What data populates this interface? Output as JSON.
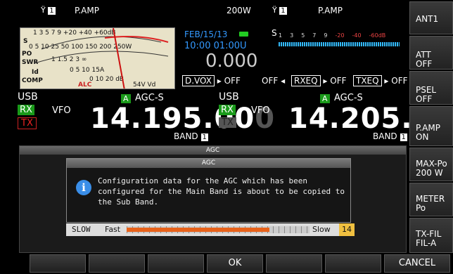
{
  "main": {
    "antenna": "1",
    "pamp": "P.AMP",
    "power": "200W",
    "date": "FEB/15/13",
    "timers": "10:00 01:00U",
    "rit": "0.000",
    "dvox_label": "D.VOX",
    "dvox_state": "OFF",
    "mode": "USB",
    "rx": "RX",
    "tx": "TX",
    "vfo": "VFO",
    "agc": "AGC-S",
    "agc_tag": "A",
    "freq": "14.195.00",
    "freq_last": "0",
    "band": "BAND",
    "band_num": "1"
  },
  "sub": {
    "antenna": "1",
    "pamp": "P.AMP",
    "s_label": "S",
    "off1": "OFF",
    "rxeq": "RXEQ",
    "rxeq_state": "OFF",
    "txeq": "TXEQ",
    "txeq_state": "OFF",
    "mode": "USB",
    "rx": "RX",
    "tx": "TX",
    "vfo": "VFO",
    "agc": "AGC-S",
    "agc_tag": "A",
    "freq": "14.205.00",
    "freq_last": "0",
    "band": "BAND",
    "band_num": "1",
    "scale": [
      "1",
      "3",
      "5",
      "7",
      "9",
      "-20",
      "-40",
      "-60dB"
    ]
  },
  "meter": {
    "s_scale": "1   3   5   7   9   +20   +40   +60dB",
    "po_scale": "0  5  10  25  50  100  150  200  250W",
    "swr_scale": "1    1.5   2    3    ∞",
    "id_scale": "0    5    10   15A",
    "comp_scale": "0    10   20 dB",
    "alc": "ALC",
    "vd_scale": "54V  Vd",
    "labels": [
      "S",
      "PO",
      "SWR",
      "Id",
      "COMP"
    ]
  },
  "right_keys": [
    {
      "l1": "ANT1",
      "l2": ""
    },
    {
      "l1": "ATT",
      "l2": "OFF"
    },
    {
      "l1": "PSEL",
      "l2": "OFF"
    },
    {
      "l1": "P.AMP",
      "l2": "ON"
    },
    {
      "l1": "MAX-Po",
      "l2": "200 W"
    },
    {
      "l1": "METER",
      "l2": "Po"
    },
    {
      "l1": "TX-FIL",
      "l2": "FIL-A"
    }
  ],
  "agc_panel": {
    "title": "AGC",
    "dialog_title": "AGC",
    "message_line1": "Configuration data for the AGC which has been",
    "message_line2": "configured for the Main Band is about to be copied to",
    "message_line3": "the Sub Band.",
    "slow_label": "SLOW",
    "fast": "Fast",
    "slow": "Slow",
    "value": "14",
    "level": 0.78
  },
  "function_keys": [
    "",
    "",
    "",
    "OK",
    "",
    "",
    "CANCEL"
  ]
}
